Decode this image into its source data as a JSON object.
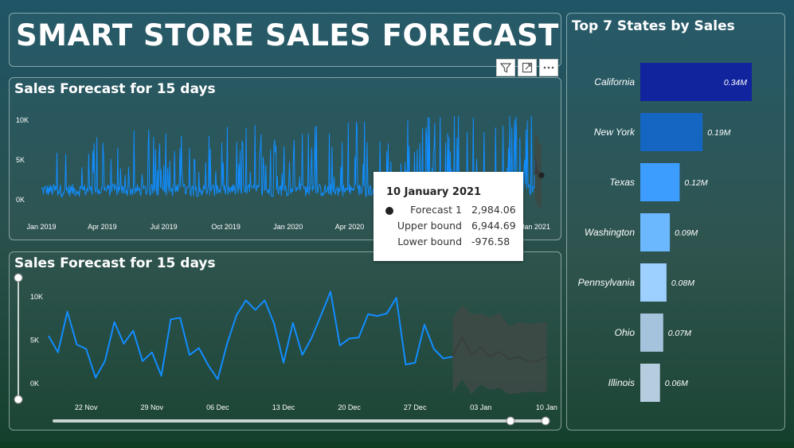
{
  "dashboard": {
    "title": "SMART STORE SALES FORECAST"
  },
  "toolbar": {
    "filter_icon": "filter-icon",
    "focus_icon": "focus-mode-icon",
    "more_icon": "more-options-icon"
  },
  "colors": {
    "actual": "#118dff",
    "forecast": "#3a3a3a",
    "band": "#3c4a46",
    "bar_shades": [
      "#12239e",
      "#1466c2",
      "#3d9dff",
      "#6cb8ff",
      "#9dcfff",
      "#a6c3dd",
      "#b6cde0"
    ]
  },
  "chart_data": [
    {
      "type": "line",
      "title": "Sales Forecast for 15 days",
      "x_tick_labels": [
        "Jan 2019",
        "Apr 2019",
        "Jul 2019",
        "Oct 2019",
        "Jan 2020",
        "Apr 2020",
        "Jan 2021"
      ],
      "y_tick_labels": [
        "10K",
        "5K",
        "0K"
      ],
      "ylim": [
        0,
        10000
      ],
      "x_range": [
        "2019-01-01",
        "2021-01-10"
      ],
      "series": [
        {
          "name": "Forecast 1",
          "note_values": "daily sales 2019-01 to 2020-12 (visible as dense spiky blue line), forecast through 2021-01-10"
        }
      ]
    },
    {
      "type": "line",
      "title": "Sales Forecast for 15 days",
      "x_tick_labels": [
        "22 Nov",
        "29 Nov",
        "06 Dec",
        "13 Dec",
        "20 Dec",
        "27 Dec",
        "03 Jan",
        "10 Jan"
      ],
      "y_tick_labels": [
        "10K",
        "5K",
        "0K"
      ],
      "ylim": [
        0,
        10000
      ],
      "actual": {
        "x_start": "2020-11-18",
        "values": [
          5400,
          3500,
          8200,
          4400,
          3900,
          600,
          2500,
          7000,
          4500,
          6000,
          2500,
          3500,
          800,
          7300,
          7500,
          3200,
          4000,
          2000,
          400,
          4500,
          7800,
          9500,
          8400,
          9500,
          6800,
          2300,
          6900,
          3200,
          5200,
          7800,
          10500,
          4300,
          5100,
          5200,
          7900,
          7700,
          8000,
          9800,
          2100,
          2300,
          6700,
          3900,
          2800,
          3000
        ]
      },
      "forecast": {
        "x_start": "2020-12-31",
        "values": [
          3000,
          5300,
          3200,
          4100,
          3000,
          3600,
          2700,
          3000,
          2500,
          2500,
          2984
        ],
        "upper_bound": [
          7400,
          9000,
          7900,
          8000,
          7500,
          8100,
          6500,
          7000,
          6800,
          6900,
          6945
        ],
        "lower_bound": [
          -1200,
          400,
          -1300,
          -200,
          -800,
          -600,
          -1300,
          -1200,
          -1000,
          -1100,
          -977
        ]
      }
    },
    {
      "type": "bar",
      "title": "Top 7 States by Sales",
      "categories": [
        "California",
        "New York",
        "Texas",
        "Washington",
        "Pennsylvania",
        "Ohio",
        "Illinois"
      ],
      "values": [
        0.34,
        0.19,
        0.12,
        0.09,
        0.08,
        0.07,
        0.06
      ],
      "value_labels": [
        "0.34M",
        "0.19M",
        "0.12M",
        "0.09M",
        "0.08M",
        "0.07M",
        "0.06M"
      ]
    }
  ],
  "tooltip": {
    "date": "10 January 2021",
    "rows": [
      {
        "label": "Forecast 1",
        "value": "2,984.06"
      },
      {
        "label": "Upper bound",
        "value": "6,944.69"
      },
      {
        "label": "Lower bound",
        "value": "-976.58"
      }
    ]
  }
}
